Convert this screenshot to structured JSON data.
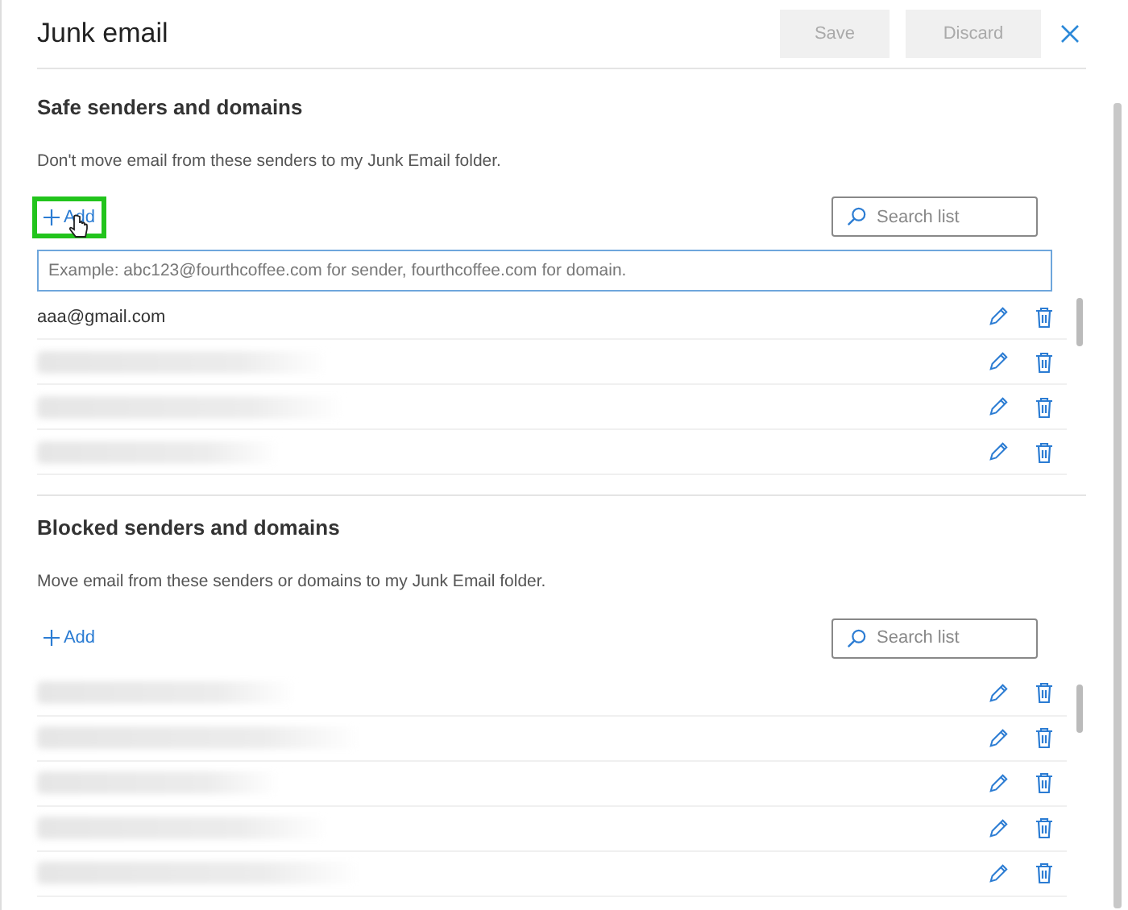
{
  "header": {
    "title": "Junk email",
    "buttons": [
      {
        "label": "Save",
        "disabled": true
      },
      {
        "label": "Discard",
        "disabled": true
      }
    ]
  },
  "sections": [
    {
      "title": "Safe senders and domains",
      "description": "Don't move email from these senders to my Junk Email folder.",
      "add": {
        "label": "Add",
        "highlighted": true
      },
      "search": {
        "placeholder": "Search list"
      },
      "new_entry": {
        "placeholder": "Example: abc123@fourthcoffee.com for sender, fourthcoffee.com for domain."
      },
      "entries": [
        {
          "kind": "email",
          "text": "aaa@gmail.com"
        },
        {
          "kind": "redacted"
        },
        {
          "kind": "redacted"
        },
        {
          "kind": "redacted"
        }
      ]
    },
    {
      "title": "Blocked senders and domains",
      "description": "Move email from these senders or domains to my Junk Email folder.",
      "add": {
        "label": "Add",
        "highlighted": false
      },
      "search": {
        "placeholder": "Search list"
      },
      "entries": [
        {
          "kind": "redacted"
        },
        {
          "kind": "redacted"
        },
        {
          "kind": "redacted"
        },
        {
          "kind": "redacted"
        },
        {
          "kind": "redacted"
        }
      ]
    }
  ]
}
